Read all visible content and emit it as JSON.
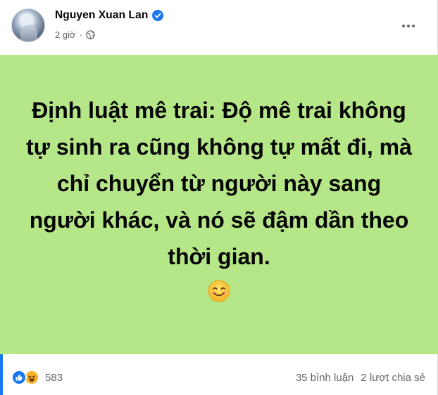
{
  "post": {
    "author": "Nguyen Xuan Lan",
    "time": "2 giờ",
    "separator": "·",
    "privacy_icon": "globe-icon",
    "verified_icon": "verified-badge-icon",
    "more_icon": "more-options-icon",
    "text": "Định luật mê trai: Độ mê trai không tự sinh ra cũng không tự mất đi, mà chỉ chuyển từ người này sang người khác, và nó sẽ đậm dần theo thời gian.",
    "emoji": "smiling-face-icon",
    "background_color": "#b5e788"
  },
  "footer": {
    "reaction_icons": [
      "like-icon",
      "haha-icon"
    ],
    "reaction_count": "583",
    "comments": "35 bình luận",
    "shares": "2 lượt chia sẻ"
  },
  "colors": {
    "accent": "#1877f2",
    "secondary_text": "#65676b",
    "haha": "#f7b125"
  }
}
